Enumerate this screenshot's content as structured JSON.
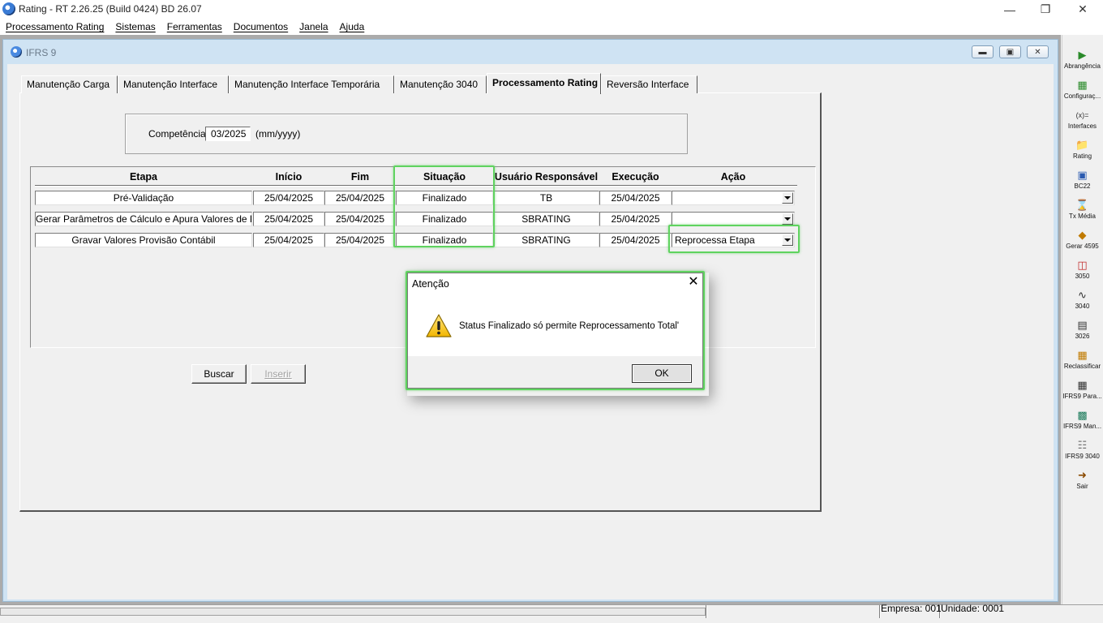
{
  "window": {
    "title": "Rating - RT 2.26.25 (Build 0424) BD 26.07"
  },
  "menu": [
    "Processamento Rating",
    "Sistemas",
    "Ferramentas",
    "Documentos",
    "Janela",
    "Ajuda"
  ],
  "child": {
    "title": "IFRS 9"
  },
  "tabs": [
    {
      "label": "Manutenção Carga"
    },
    {
      "label": "Manutenção Interface"
    },
    {
      "label": "Manutenção Interface Temporária"
    },
    {
      "label": "Manutenção 3040"
    },
    {
      "label": "Processamento Rating"
    },
    {
      "label": "Reversão Interface"
    }
  ],
  "competencia": {
    "label": "Competência",
    "value": "03/2025",
    "format": "(mm/yyyy)"
  },
  "grid": {
    "columns": [
      "Etapa",
      "Início",
      "Fim",
      "Situação",
      "Usuário Responsável",
      "Execução",
      "Ação"
    ],
    "rows": [
      {
        "etapa": "Pré-Validação",
        "inicio": "25/04/2025",
        "fim": "25/04/2025",
        "situacao": "Finalizado",
        "usuario": "TB",
        "execucao": "25/04/2025",
        "acao": ""
      },
      {
        "etapa": "Gerar Parâmetros de Cálculo e Apura Valores de Perda",
        "inicio": "25/04/2025",
        "fim": "25/04/2025",
        "situacao": "Finalizado",
        "usuario": "SBRATING",
        "execucao": "25/04/2025",
        "acao": ""
      },
      {
        "etapa": "Gravar Valores Provisão Contábil",
        "inicio": "25/04/2025",
        "fim": "25/04/2025",
        "situacao": "Finalizado",
        "usuario": "SBRATING",
        "execucao": "25/04/2025",
        "acao": "Reprocessa Etapa"
      }
    ]
  },
  "buttons": {
    "buscar": "Buscar",
    "inserir": "Inserir"
  },
  "dialog": {
    "title": "Atenção",
    "message": "Status Finalizado só permite Reprocessamento Total'",
    "ok": "OK"
  },
  "toolbar": [
    {
      "label": "Abrangência",
      "icon": "abrangencia-icon"
    },
    {
      "label": "Configuraç...",
      "icon": "configuracao-icon"
    },
    {
      "label": "Interfaces",
      "icon": "interfaces-icon"
    },
    {
      "label": "Rating",
      "icon": "folder-icon"
    },
    {
      "label": "BC22",
      "icon": "cube-icon"
    },
    {
      "label": "Tx Média",
      "icon": "tx-media-icon"
    },
    {
      "label": "Gerar 4595",
      "icon": "gerar-icon"
    },
    {
      "label": "3050",
      "icon": "3050-icon"
    },
    {
      "label": "3040",
      "icon": "3040-icon"
    },
    {
      "label": "3026",
      "icon": "3026-icon"
    },
    {
      "label": "Reclassificar",
      "icon": "reclassificar-icon"
    },
    {
      "label": "IFRS9 Para...",
      "icon": "ifrs9-param-icon"
    },
    {
      "label": "IFRS9 Man...",
      "icon": "ifrs9-man-icon"
    },
    {
      "label": "IFRS9 3040",
      "icon": "database-icon"
    },
    {
      "label": "Sair",
      "icon": "exit-icon"
    }
  ],
  "status": {
    "empresa": "Empresa: 001",
    "unidade": "Unidade: 0001"
  },
  "colors": {
    "highlight": "#5fd35f",
    "accent": "#3a7bd5"
  }
}
